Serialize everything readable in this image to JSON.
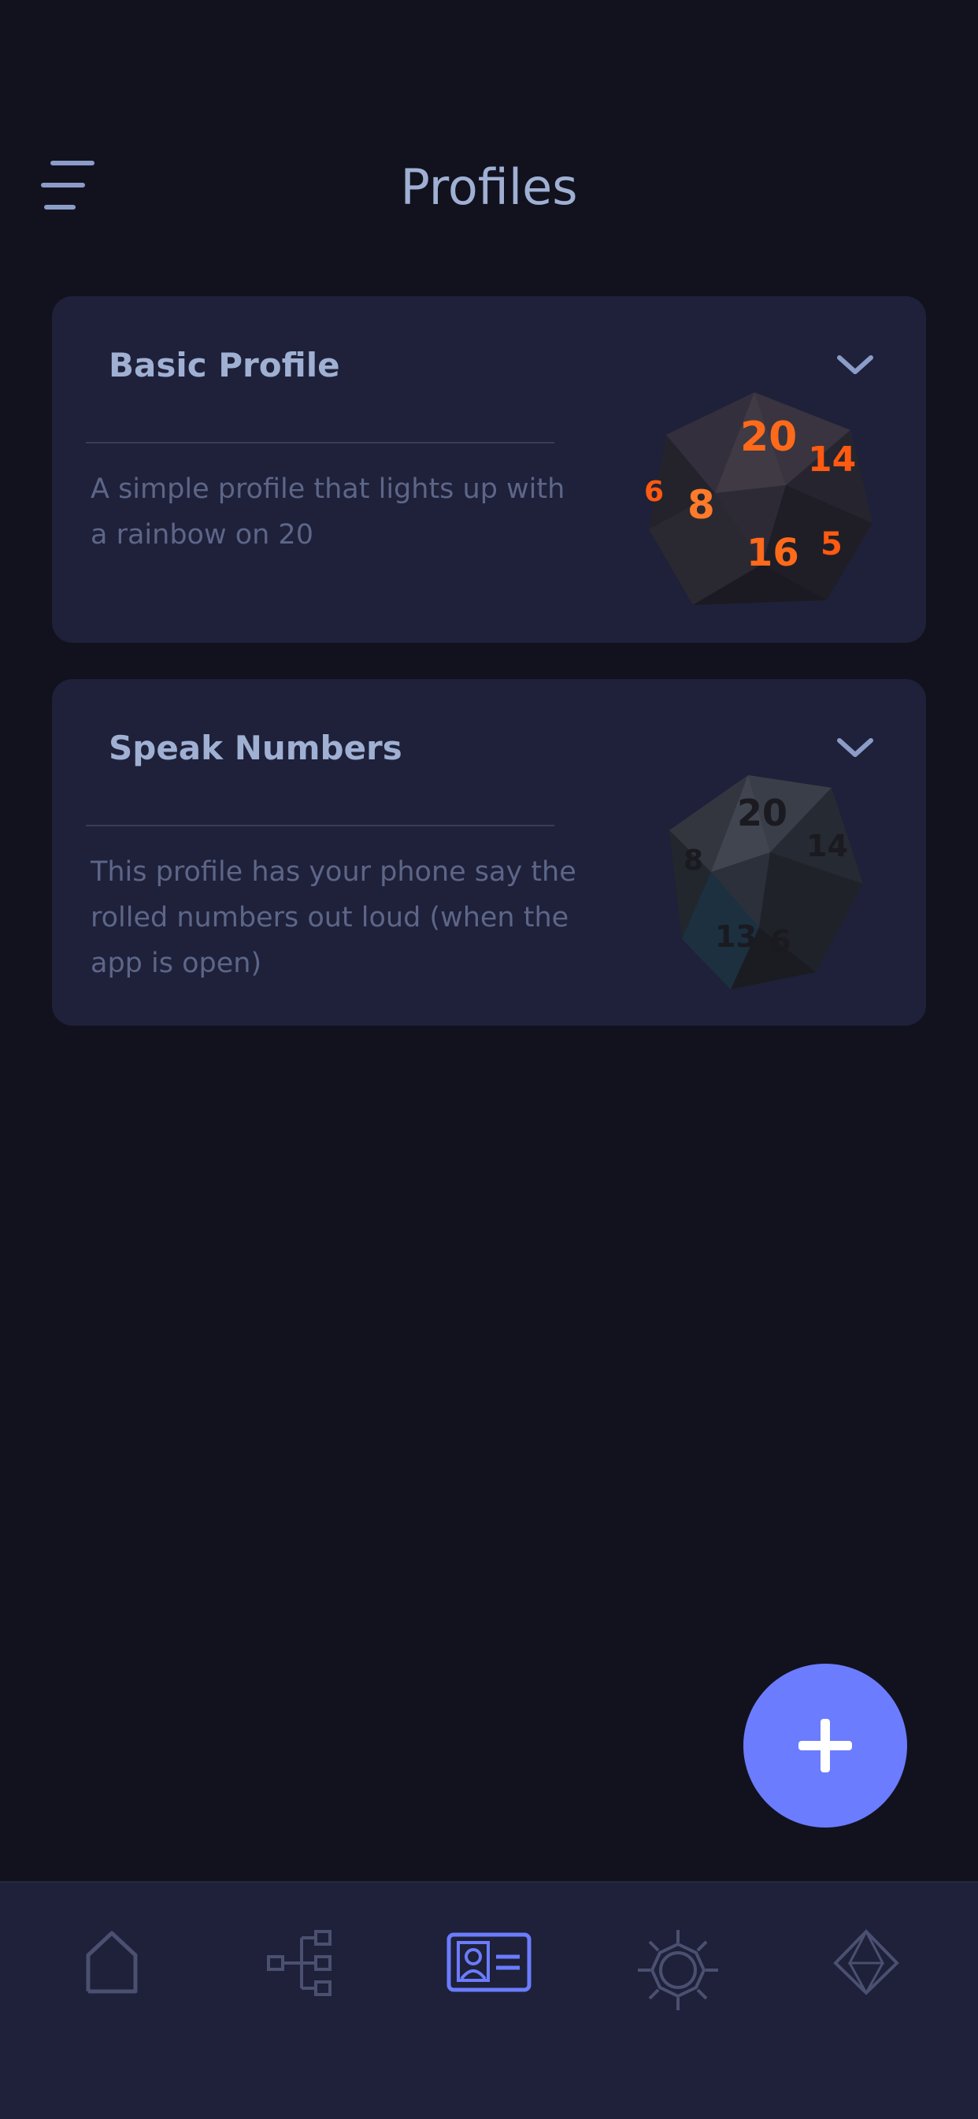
{
  "header": {
    "title": "Profiles",
    "menu_icon": "hamburger-menu-icon"
  },
  "profiles": [
    {
      "title": "Basic Profile",
      "description": "A simple profile that lights up with a rainbow on 20",
      "image": "glowing-d20-die",
      "expand_icon": "chevron-down-icon"
    },
    {
      "title": "Speak Numbers",
      "description": "This profile has your phone say the rolled numbers out loud (when the app is open)",
      "image": "dark-d20-die",
      "expand_icon": "chevron-down-icon"
    }
  ],
  "fab": {
    "icon": "plus-icon"
  },
  "bottom_nav": {
    "items": [
      {
        "icon": "home-icon",
        "active": false
      },
      {
        "icon": "tree-structure-icon",
        "active": false
      },
      {
        "icon": "profile-card-icon",
        "active": true
      },
      {
        "icon": "gear-sun-icon",
        "active": false
      },
      {
        "icon": "d20-icon",
        "active": false
      }
    ]
  },
  "colors": {
    "background": "#12121f",
    "card": "#1e2139",
    "accent": "#6b7cff",
    "title_text": "#9fb0d3",
    "body_text": "#5d6688",
    "nav_icon_inactive": "#4b5070"
  }
}
